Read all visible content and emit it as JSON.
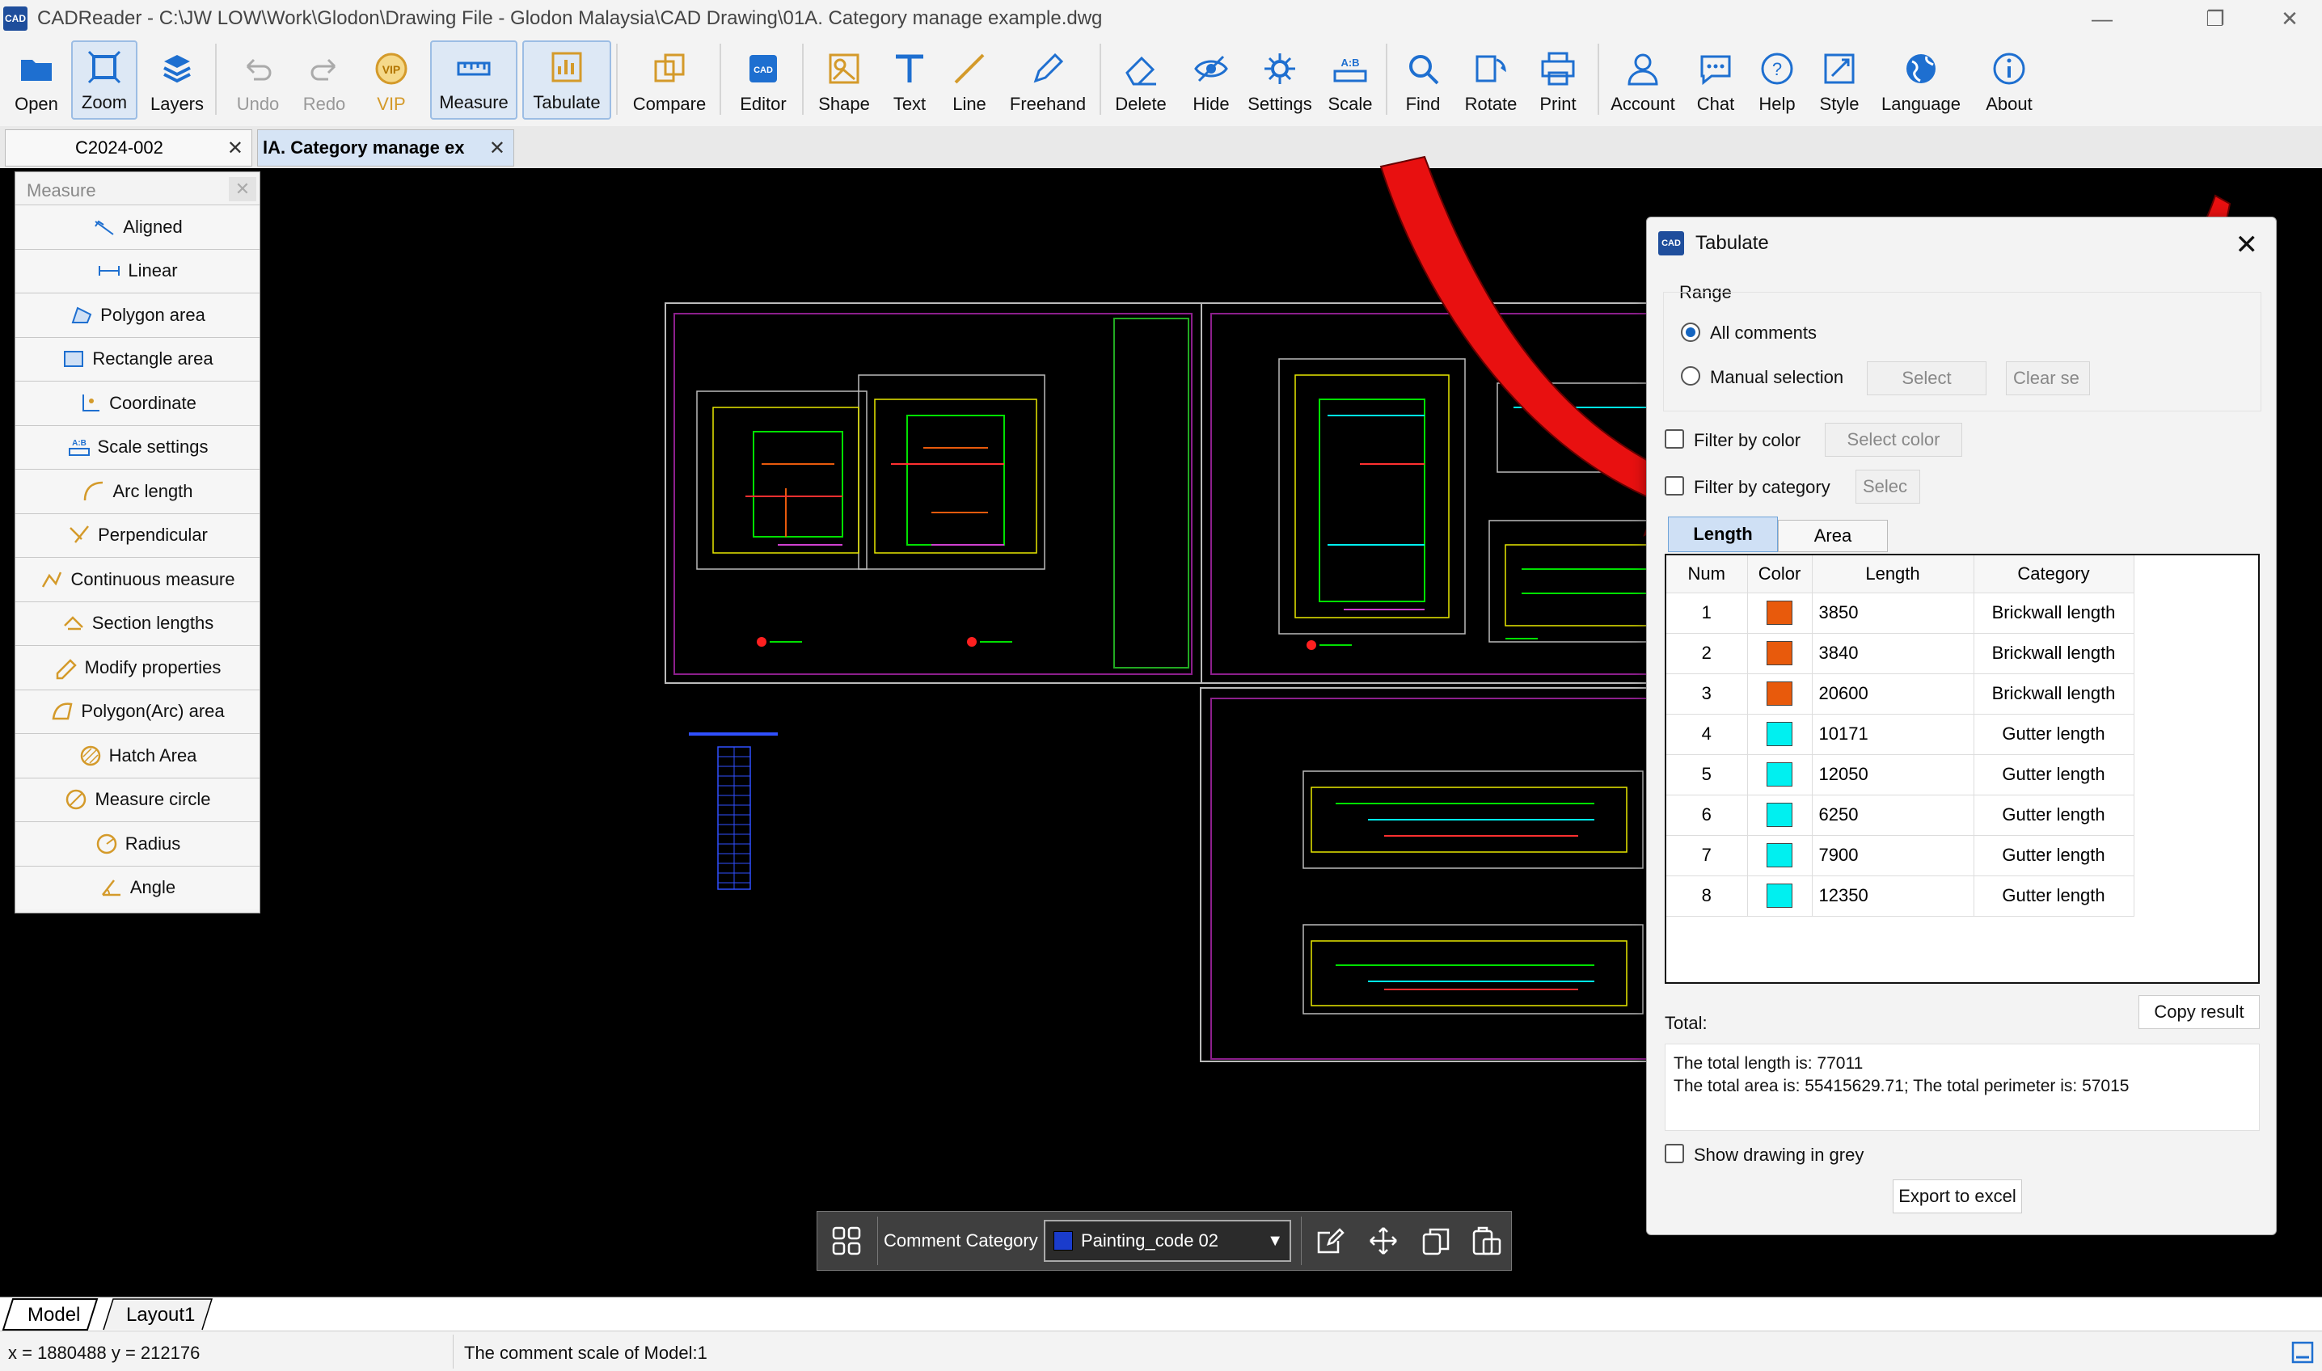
{
  "window": {
    "app_logo": "CAD",
    "title": "CADReader - C:\\JW LOW\\Work\\Glodon\\Drawing File - Glodon Malaysia\\CAD Drawing\\01A. Category manage example.dwg",
    "minimize": "—",
    "maximize": "❐",
    "close": "✕"
  },
  "toolbar": {
    "open": "Open",
    "zoom": "Zoom",
    "layers": "Layers",
    "undo": "Undo",
    "redo": "Redo",
    "vip": "VIP",
    "measure": "Measure",
    "tabulate": "Tabulate",
    "compare": "Compare",
    "editor": "Editor",
    "shape": "Shape",
    "text": "Text",
    "line": "Line",
    "freehand": "Freehand",
    "delete": "Delete",
    "hide": "Hide",
    "settings": "Settings",
    "scale": "Scale",
    "find": "Find",
    "rotate": "Rotate",
    "print": "Print",
    "account": "Account",
    "chat": "Chat",
    "help": "Help",
    "style": "Style",
    "language": "Language",
    "about": "About"
  },
  "doc_tabs": [
    {
      "label": "C2024-002",
      "close": "✕"
    },
    {
      "label": "lA. Category manage ex",
      "close": "✕"
    }
  ],
  "measure_panel": {
    "title": "Measure",
    "close": "✕",
    "items": [
      "Aligned",
      "Linear",
      "Polygon area",
      "Rectangle area",
      "Coordinate",
      "Scale settings",
      "Arc length",
      "Perpendicular",
      "Continuous measure",
      "Section lengths",
      "Modify properties",
      "Polygon(Arc) area",
      "Hatch Area",
      "Measure circle",
      "Radius",
      "Angle"
    ]
  },
  "tabulate": {
    "logo": "CAD",
    "title": "Tabulate",
    "close": "✕",
    "range_label": "Range",
    "all_comments": "All comments",
    "manual_selection": "Manual selection",
    "select_btn": "Select",
    "clear_btn": "Clear se",
    "filter_color": "Filter by color",
    "select_color": "Select color",
    "filter_category": "Filter by category",
    "select_cat": "Selec",
    "tab_length": "Length",
    "tab_area": "Area",
    "columns": [
      "Num",
      "Color",
      "Length",
      "Category"
    ],
    "rows": [
      {
        "num": "1",
        "color": "#e85a0c",
        "length": "3850",
        "category": "Brickwall length"
      },
      {
        "num": "2",
        "color": "#e85a0c",
        "length": "3840",
        "category": "Brickwall length"
      },
      {
        "num": "3",
        "color": "#e85a0c",
        "length": "20600",
        "category": "Brickwall length"
      },
      {
        "num": "4",
        "color": "#00f0f0",
        "length": "10171",
        "category": "Gutter length"
      },
      {
        "num": "5",
        "color": "#00f0f0",
        "length": "12050",
        "category": "Gutter length"
      },
      {
        "num": "6",
        "color": "#00f0f0",
        "length": "6250",
        "category": "Gutter length"
      },
      {
        "num": "7",
        "color": "#00f0f0",
        "length": "7900",
        "category": "Gutter length"
      },
      {
        "num": "8",
        "color": "#00f0f0",
        "length": "12350",
        "category": "Gutter length"
      }
    ],
    "total_label": "Total:",
    "copy_result": "Copy result",
    "total_line1": "The total length is: 77011",
    "total_line2": "The total area is: 55415629.71; The total perimeter is: 57015",
    "show_grey": "Show drawing in grey",
    "export": "Export to excel"
  },
  "comment_bar": {
    "label": "Comment Category",
    "selected": "Painting_code 02",
    "swatch_color": "#1a3ccc",
    "arrow": "▼"
  },
  "layout_tabs": [
    "Model",
    "Layout1"
  ],
  "status": {
    "coords": "x = 1880488 y = 212176",
    "scale": "The comment scale of Model:1"
  }
}
